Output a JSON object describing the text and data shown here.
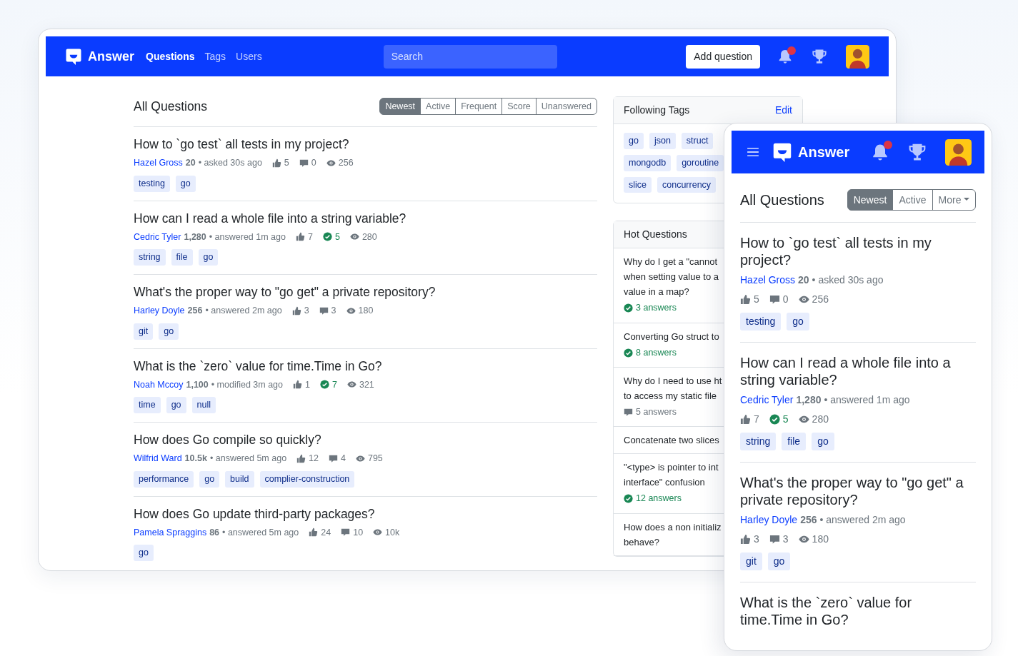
{
  "desktop": {
    "navbar": {
      "brand": "Answer",
      "links": [
        {
          "label": "Questions",
          "selected": true
        },
        {
          "label": "Tags",
          "selected": false
        },
        {
          "label": "Users",
          "selected": false
        }
      ],
      "search": {
        "placeholder": "Search"
      },
      "add_button": "Add question",
      "notification_dot": true
    },
    "heading": "All Questions",
    "sort_tabs": [
      {
        "label": "Newest",
        "selected": true
      },
      {
        "label": "Active",
        "selected": false
      },
      {
        "label": "Frequent",
        "selected": false
      },
      {
        "label": "Score",
        "selected": false
      },
      {
        "label": "Unanswered",
        "selected": false
      }
    ],
    "questions": [
      {
        "title": "How to `go test` all tests in my project?",
        "author": "Hazel Gross",
        "reputation": "20",
        "activity": "• asked 30s ago",
        "votes": "5",
        "answers": "0",
        "accepted": false,
        "views": "256",
        "tags": [
          "testing",
          "go"
        ]
      },
      {
        "title": "How can I read a whole file into a string variable?",
        "author": "Cedric Tyler",
        "reputation": "1,280",
        "activity": "• answered 1m ago",
        "votes": "7",
        "answers": "5",
        "accepted": true,
        "views": "280",
        "tags": [
          "string",
          "file",
          "go"
        ]
      },
      {
        "title": "What's the proper way to \"go get\" a private repository?",
        "author": "Harley Doyle",
        "reputation": "256",
        "activity": "• answered 2m ago",
        "votes": "3",
        "answers": "3",
        "accepted": false,
        "views": "180",
        "tags": [
          "git",
          "go"
        ]
      },
      {
        "title": "What is the `zero` value for time.Time in Go?",
        "author": "Noah Mccoy",
        "reputation": "1,100",
        "activity": "• modified 3m ago",
        "votes": "1",
        "answers": "7",
        "accepted": true,
        "views": "321",
        "tags": [
          "time",
          "go",
          "null"
        ]
      },
      {
        "title": "How does Go compile so quickly?",
        "author": "Wilfrid Ward",
        "reputation": "10.5k",
        "activity": "• answered 5m ago",
        "votes": "12",
        "answers": "4",
        "accepted": false,
        "views": "795",
        "tags": [
          "performance",
          "go",
          "build",
          "complier-construction"
        ]
      },
      {
        "title": "How does Go update third-party packages?",
        "author": "Pamela Spraggins",
        "reputation": "86",
        "activity": "• answered 5m ago",
        "votes": "24",
        "answers": "10",
        "accepted": false,
        "views": "10k",
        "tags": [
          "go"
        ]
      }
    ],
    "following_tags": {
      "title": "Following Tags",
      "edit": "Edit",
      "tag_rows": [
        [
          "go",
          "json",
          "struct"
        ],
        [
          "mongodb",
          "goroutine"
        ],
        [
          "slice",
          "concurrency"
        ]
      ]
    },
    "hot_questions": {
      "title": "Hot Questions",
      "items": [
        {
          "lines": [
            "Why do I get a \"cannot",
            "when setting value to a",
            "value in a map?"
          ],
          "answers": "3 answers",
          "accepted": true
        },
        {
          "lines": [
            "Converting Go struct to"
          ],
          "answers": "8 answers",
          "accepted": true
        },
        {
          "lines": [
            "Why do I need to use ht",
            "to access my static file"
          ],
          "answers": "5 answers",
          "accepted": false
        },
        {
          "lines": [
            "Concatenate two slices"
          ]
        },
        {
          "lines": [
            "\"<type> is pointer to int",
            "interface\" confusion"
          ],
          "answers": "12 answers",
          "accepted": true
        },
        {
          "lines": [
            "How does a non initializ",
            "behave?"
          ]
        }
      ]
    }
  },
  "mobile": {
    "navbar": {
      "brand": "Answer",
      "notification_dot": true
    },
    "heading": "All Questions",
    "sort_tabs": [
      {
        "label": "Newest",
        "selected": true,
        "kind": "tab"
      },
      {
        "label": "Active",
        "selected": false,
        "kind": "tab"
      },
      {
        "label": "More",
        "selected": false,
        "kind": "dropdown"
      }
    ],
    "questions": [
      {
        "title": "How to `go test` all tests in my project?",
        "author": "Hazel Gross",
        "reputation": "20",
        "activity": "• asked 30s ago",
        "votes": "5",
        "answers": "0",
        "accepted": false,
        "views": "256",
        "tags": [
          "testing",
          "go"
        ]
      },
      {
        "title": "How can I read a whole file into a string variable?",
        "author": "Cedric Tyler",
        "reputation": "1,280",
        "activity": "• answered 1m ago",
        "votes": "7",
        "answers": "5",
        "accepted": true,
        "views": "280",
        "tags": [
          "string",
          "file",
          "go"
        ]
      },
      {
        "title": "What's the proper way to \"go get\" a private repository?",
        "author": "Harley Doyle",
        "reputation": "256",
        "activity": "• answered 2m ago",
        "votes": "3",
        "answers": "3",
        "accepted": false,
        "views": "180",
        "tags": [
          "git",
          "go"
        ]
      },
      {
        "title": "What is the `zero` value for time.Time in Go?"
      }
    ]
  }
}
